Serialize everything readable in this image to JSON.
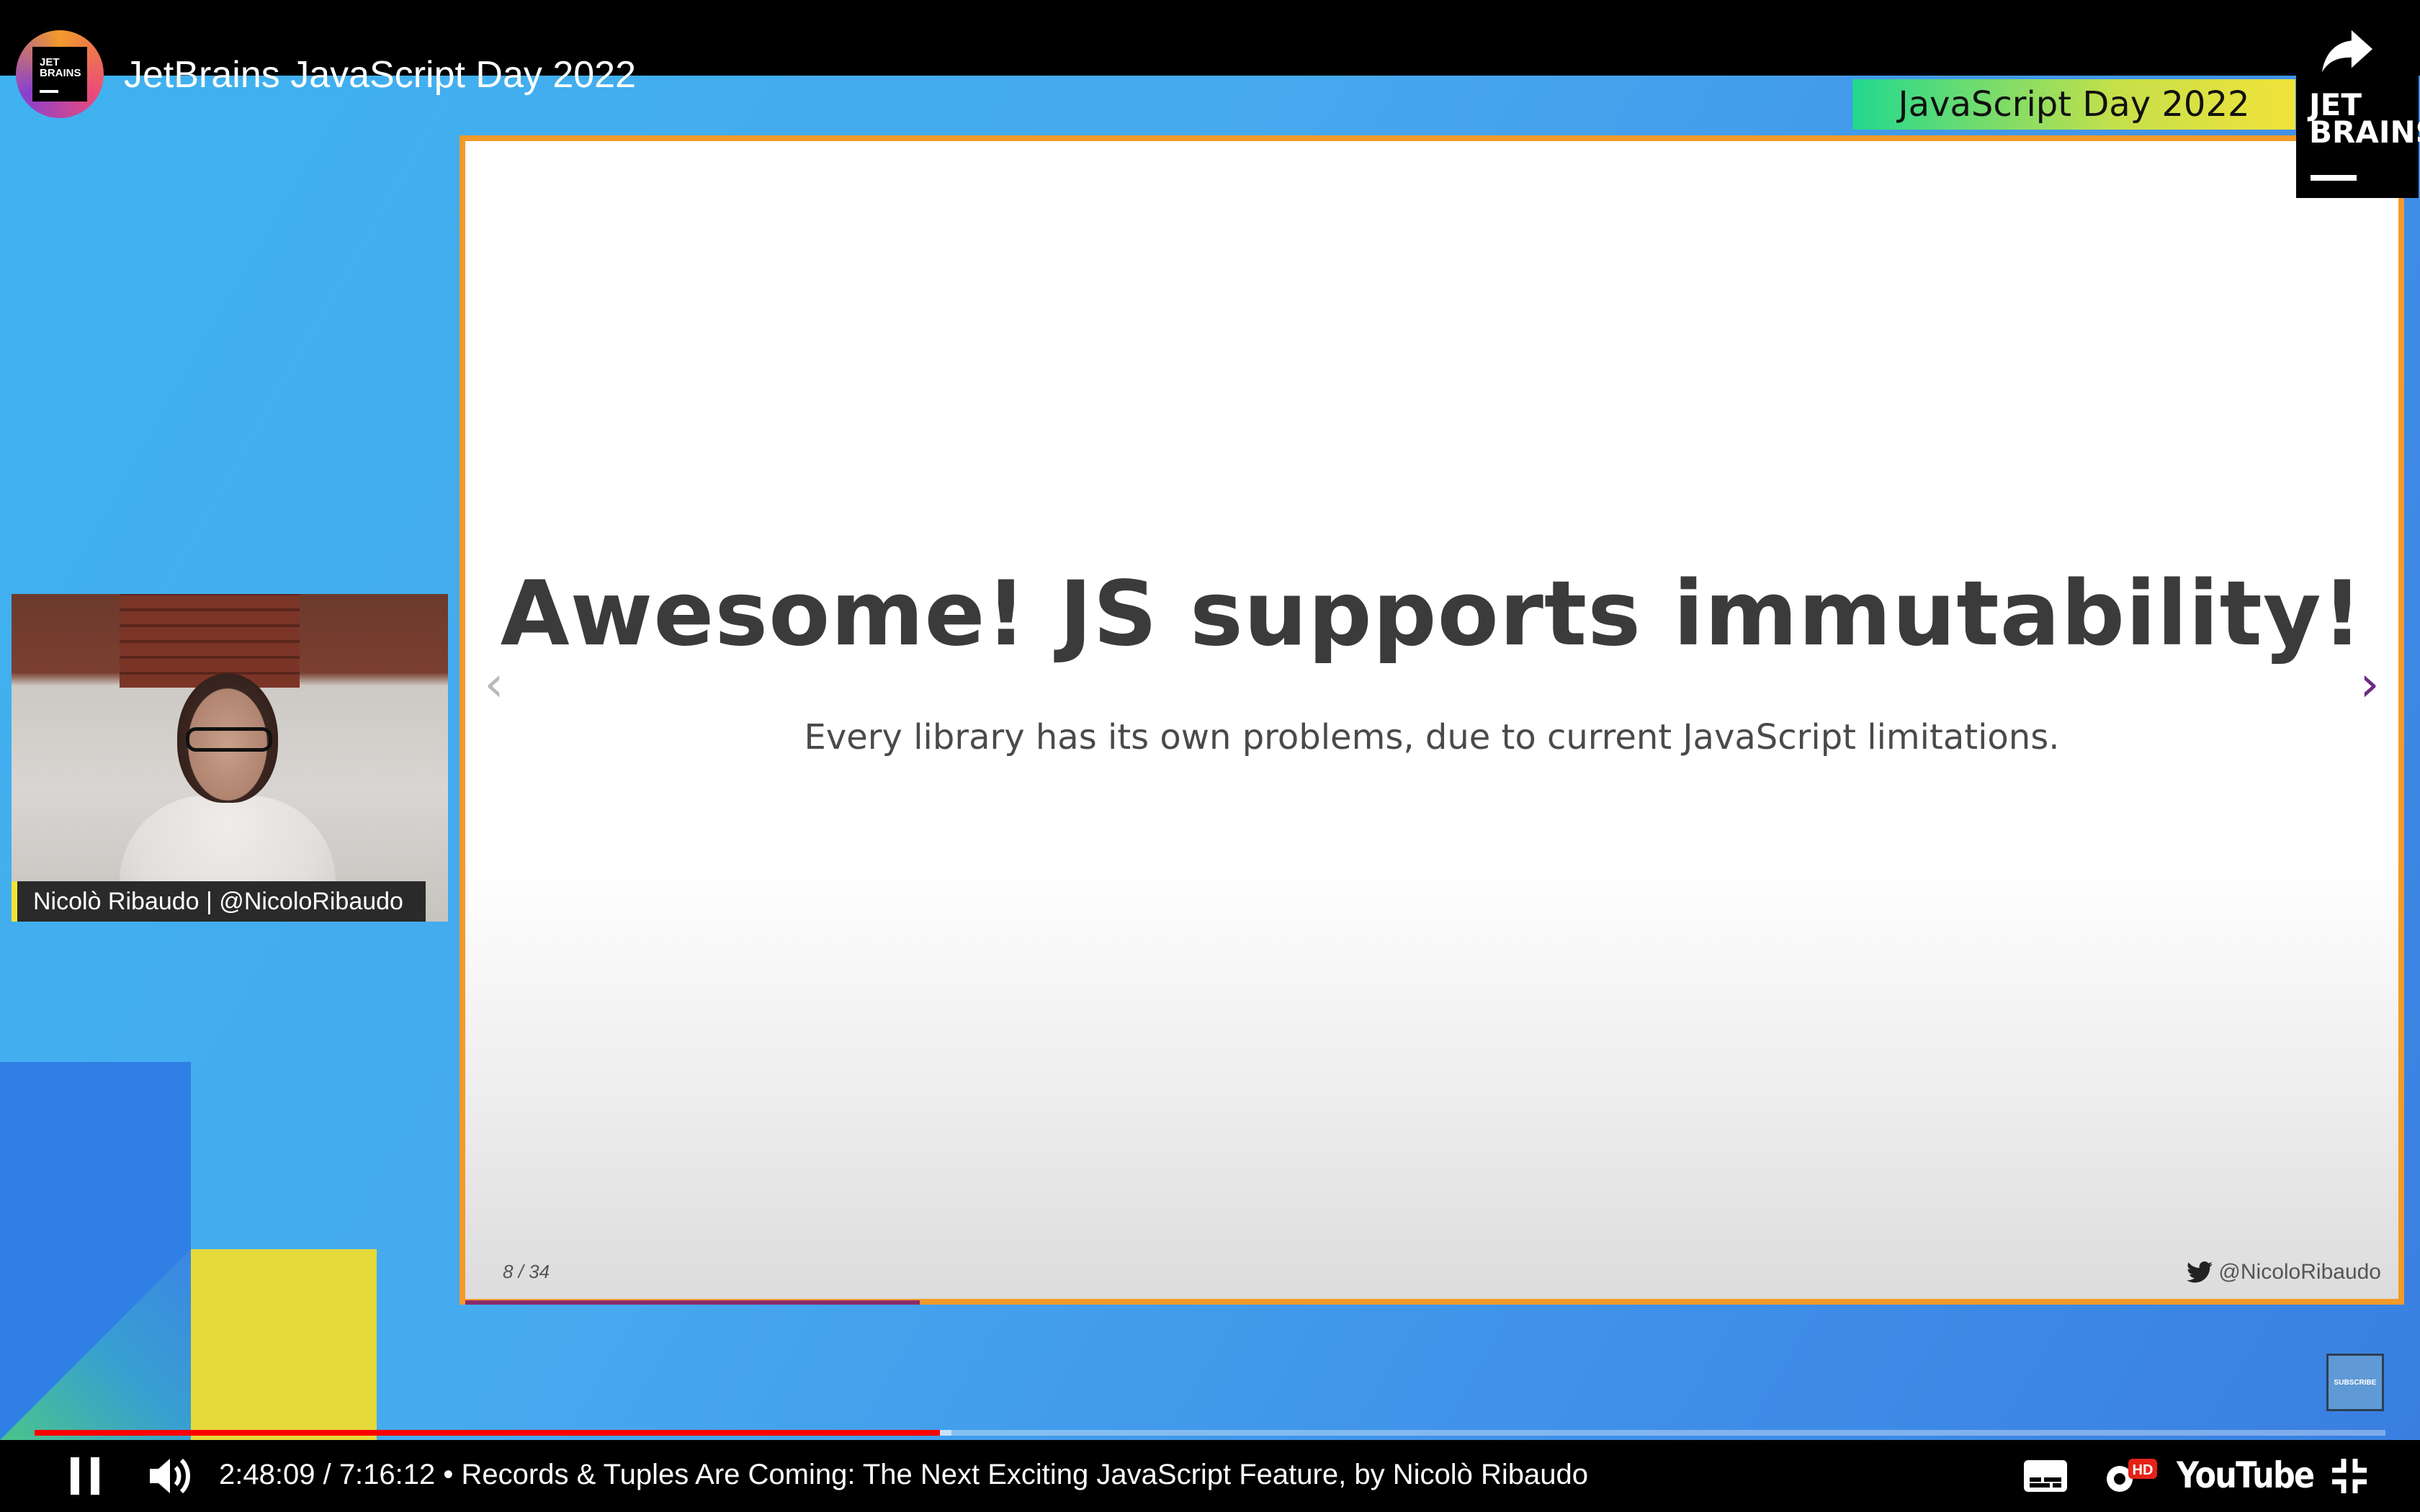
{
  "header": {
    "channel_avatar_text": "JET BRAINS",
    "video_title": "JetBrains JavaScript Day 2022",
    "share_label": "分享"
  },
  "video": {
    "event_badge": "JavaScript Day 2022",
    "brand_logo": "JET BRAINS",
    "speaker_label": "Nicolò Ribaudo | @NicoloRibaudo",
    "slide": {
      "title": "Awesome! JS supports immutability!",
      "subtitle": "Every library has its own problems, due to current JavaScript limitations.",
      "counter": "8 / 34",
      "handle": "@NicoloRibaudo",
      "progress": 0.235
    },
    "subscribe_label": "SUBSCRIBE"
  },
  "player": {
    "current_time": "2:48:09",
    "duration": "7:16:12",
    "separator": " / ",
    "chapter": "• Records & Tuples Are Coming: The Next Exciting JavaScript Feature, by Nicolò Ribaudo",
    "played_fraction": 0.385,
    "buffered_fraction": 0.39,
    "quality_badge": "HD",
    "logo_text": "YouTube",
    "accent_color": "#ff0000"
  }
}
